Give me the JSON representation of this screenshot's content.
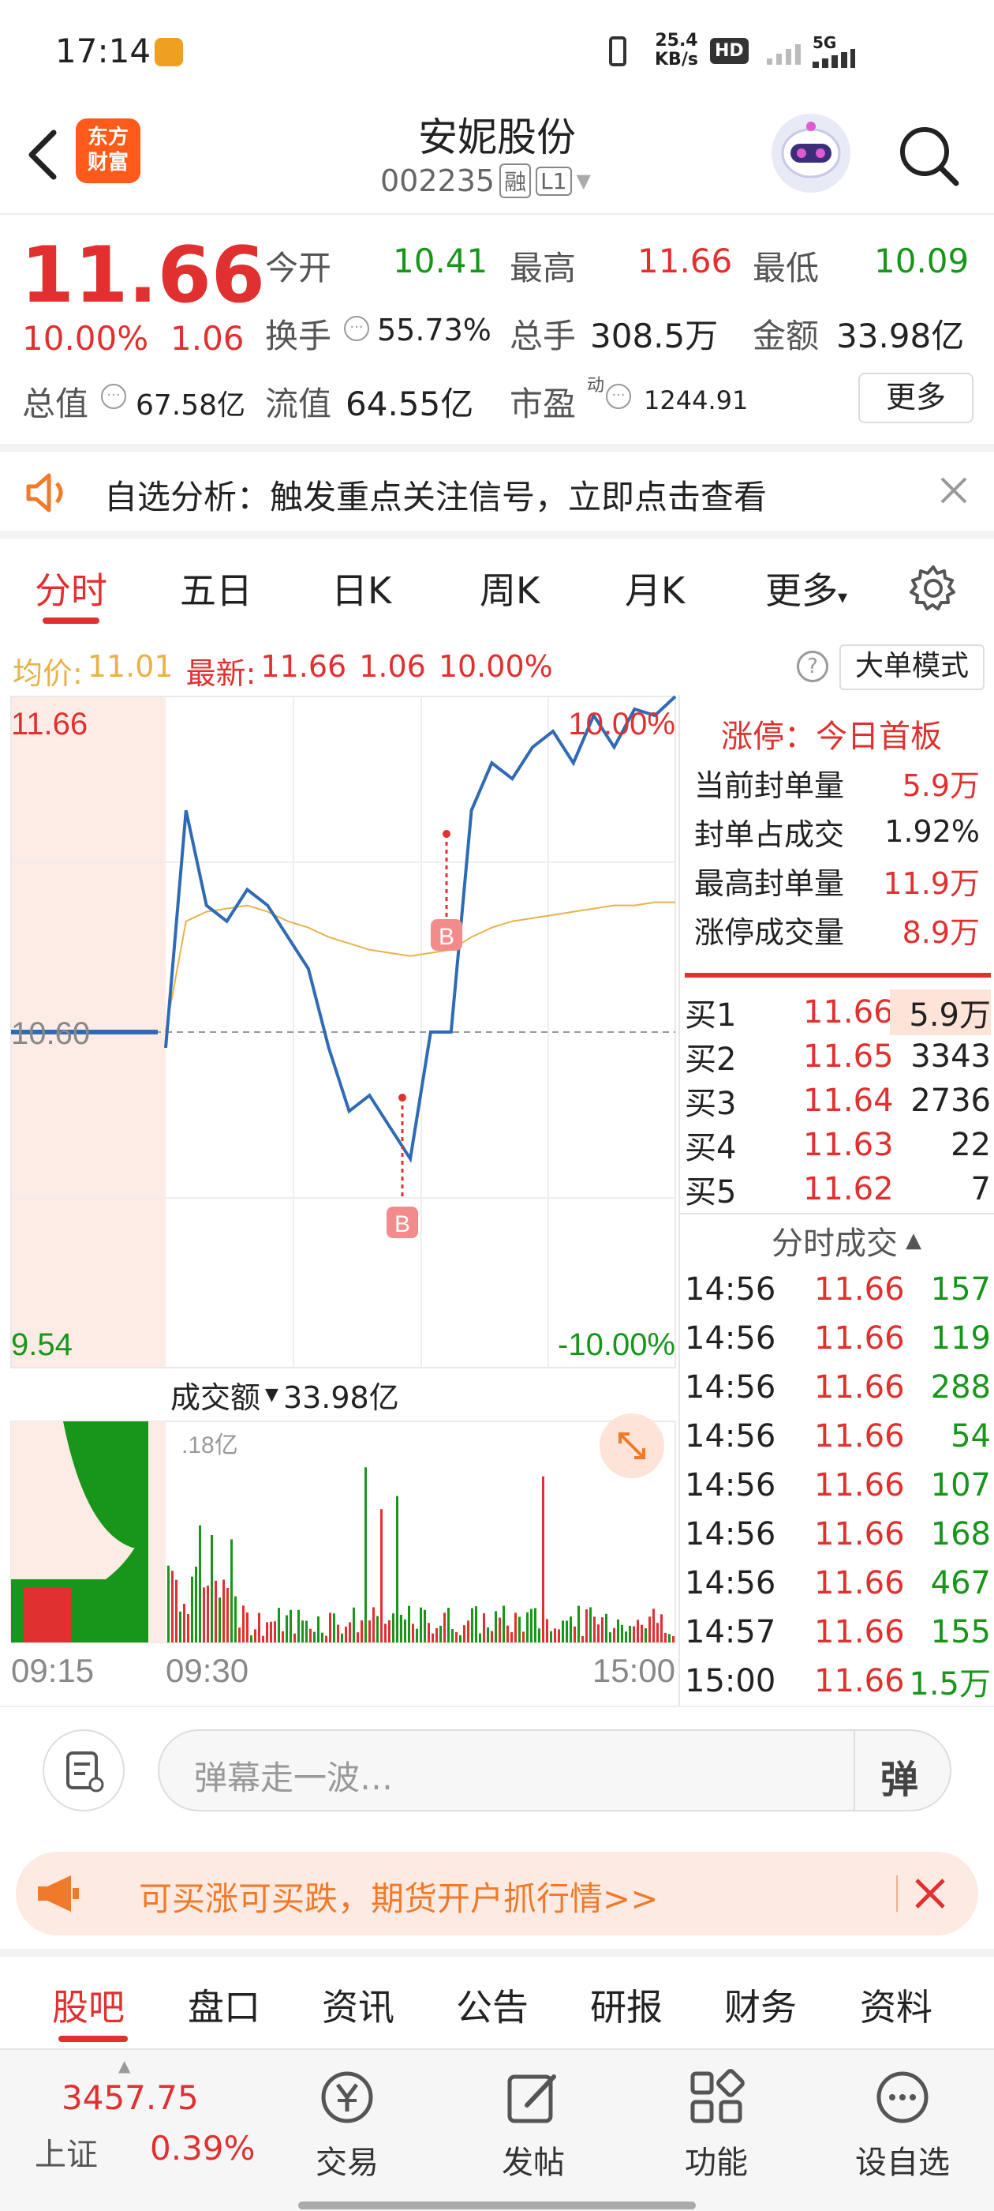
{
  "status_bar": {
    "time": "17:14",
    "network_speed_value": "25.4",
    "network_speed_unit": "KB/s",
    "hd": "HD",
    "signal": "5G"
  },
  "header": {
    "back": "back",
    "logo_line1": "东方",
    "logo_line2": "财富",
    "stock_name": "安妮股份",
    "stock_code": "002235",
    "tag_rong": "融",
    "tag_level": "L1"
  },
  "quote": {
    "price": "11.66",
    "change_pct": "10.00%",
    "change_amt": "1.06",
    "open_label": "今开",
    "open": "10.41",
    "high_label": "最高",
    "high": "11.66",
    "low_label": "最低",
    "low": "10.09",
    "turnover_label": "换手",
    "turnover": "55.73%",
    "volume_label": "总手",
    "volume": "308.5万",
    "amount_label": "金额",
    "amount": "33.98亿",
    "mktcap_label": "总值",
    "mktcap": "67.58亿",
    "float_label": "流值",
    "float": "64.55亿",
    "pe_label": "市盈",
    "pe_sup": "动",
    "pe": "1244.91",
    "more": "更多"
  },
  "notice": {
    "text": "自选分析：触发重点关注信号，立即点击查看"
  },
  "tabs": {
    "items": [
      "分时",
      "五日",
      "日K",
      "周K",
      "月K",
      "更多"
    ],
    "active": 0
  },
  "info_bar": {
    "avg_label": "均价:",
    "avg": "11.01",
    "latest_label": "最新:",
    "latest": "11.66",
    "chg": "1.06",
    "pct": "10.00%",
    "mode": "大单模式"
  },
  "chart": {
    "y_top": "11.66",
    "y_mid": "10.60",
    "y_bot": "9.54",
    "pct_top": "10.00%",
    "pct_bot": "-10.00%",
    "vol_label": "成交额",
    "vol_value": "33.98亿",
    "vol_max": ".18亿",
    "x_start": "09:15",
    "x_open": "09:30",
    "x_end": "15:00",
    "marker": "B"
  },
  "chart_data": {
    "type": "line",
    "x": [
      "09:30",
      "09:40",
      "09:50",
      "10:00",
      "10:10",
      "10:20",
      "10:30",
      "10:40",
      "10:50",
      "11:00",
      "11:10",
      "11:20",
      "11:30",
      "13:00",
      "13:10",
      "13:20",
      "13:30",
      "13:40",
      "13:50",
      "14:00",
      "14:10",
      "14:20",
      "14:30",
      "14:40",
      "14:50",
      "15:00"
    ],
    "series": [
      {
        "values": [
          10.55,
          11.3,
          11.0,
          10.95,
          11.05,
          11.0,
          10.9,
          10.8,
          10.55,
          10.35,
          10.4,
          10.3,
          10.2,
          10.6,
          10.6,
          11.3,
          11.45,
          11.4,
          11.5,
          11.55,
          11.45,
          11.6,
          11.5,
          11.62,
          11.6,
          11.66
        ]
      },
      {
        "values": [
          10.6,
          10.95,
          10.98,
          10.99,
          11.0,
          10.98,
          10.95,
          10.93,
          10.9,
          10.88,
          10.86,
          10.85,
          10.84,
          10.85,
          10.86,
          10.9,
          10.93,
          10.95,
          10.96,
          10.97,
          10.98,
          10.99,
          11.0,
          11.0,
          11.01,
          11.01
        ]
      }
    ],
    "ylim": [
      9.54,
      11.66
    ],
    "prev_close": 10.6
  },
  "limit_panel": {
    "title": "涨停：今日首板",
    "rows": [
      {
        "label": "当前封单量",
        "value": "5.9万"
      },
      {
        "label": "封单占成交",
        "value": "1.92%"
      },
      {
        "label": "最高封单量",
        "value": "11.9万"
      },
      {
        "label": "涨停成交量",
        "value": "8.9万"
      }
    ]
  },
  "order_book": [
    {
      "label": "买1",
      "price": "11.66",
      "vol": "5.9万"
    },
    {
      "label": "买2",
      "price": "11.65",
      "vol": "3343"
    },
    {
      "label": "买3",
      "price": "11.64",
      "vol": "2736"
    },
    {
      "label": "买4",
      "price": "11.63",
      "vol": "22"
    },
    {
      "label": "买5",
      "price": "11.62",
      "vol": "7"
    }
  ],
  "ticks": {
    "title": "分时成交",
    "rows": [
      {
        "time": "14:56",
        "price": "11.66",
        "vol": "157"
      },
      {
        "time": "14:56",
        "price": "11.66",
        "vol": "119"
      },
      {
        "time": "14:56",
        "price": "11.66",
        "vol": "288"
      },
      {
        "time": "14:56",
        "price": "11.66",
        "vol": "54"
      },
      {
        "time": "14:56",
        "price": "11.66",
        "vol": "107"
      },
      {
        "time": "14:56",
        "price": "11.66",
        "vol": "168"
      },
      {
        "time": "14:56",
        "price": "11.66",
        "vol": "467"
      },
      {
        "time": "14:57",
        "price": "11.66",
        "vol": "155"
      },
      {
        "time": "15:00",
        "price": "11.66",
        "vol": "1.5万"
      }
    ]
  },
  "danmu": {
    "placeholder": "弹幕走一波…",
    "button": "弹"
  },
  "ad": {
    "text": "可买涨可买跌，期货开户抓行情>>"
  },
  "bottom_tabs": {
    "items": [
      "股吧",
      "盘口",
      "资讯",
      "公告",
      "研报",
      "财务",
      "资料"
    ],
    "active": 0
  },
  "dock": {
    "index_value": "3457.75",
    "index_name": "上证",
    "index_pct": "0.39%",
    "items": [
      {
        "label": "交易",
        "icon": "yen-icon"
      },
      {
        "label": "发帖",
        "icon": "edit-icon"
      },
      {
        "label": "功能",
        "icon": "grid-icon"
      },
      {
        "label": "设自选",
        "icon": "more-icon"
      }
    ]
  },
  "colors": {
    "up": "#e0302f",
    "down": "#17961a",
    "price_line": "#2f6bb5",
    "avg_line": "#e8b24a",
    "brand": "#ff6a1a"
  }
}
